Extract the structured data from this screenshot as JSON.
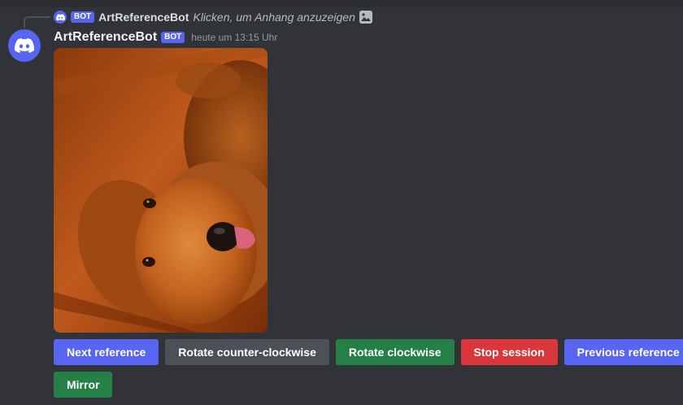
{
  "reply": {
    "bot_tag": "BOT",
    "author": "ArtReferenceBot",
    "text": "Klicken, um Anhang anzuzeigen"
  },
  "message": {
    "author": "ArtReferenceBot",
    "bot_tag": "BOT",
    "timestamp": "heute um 13:15 Uhr",
    "attachment": "golden-retriever-photo"
  },
  "buttons": {
    "row1": [
      {
        "label": "Next reference",
        "style": "primary"
      },
      {
        "label": "Rotate counter-clockwise",
        "style": "secondary"
      },
      {
        "label": "Rotate clockwise",
        "style": "success"
      },
      {
        "label": "Stop session",
        "style": "danger"
      },
      {
        "label": "Previous reference",
        "style": "primary"
      }
    ],
    "row2": [
      {
        "label": "Mirror",
        "style": "success"
      }
    ]
  },
  "colors": {
    "background": "#313338",
    "blurple": "#5865f2",
    "grey": "#4e5058",
    "green": "#248046",
    "red": "#da373c"
  }
}
